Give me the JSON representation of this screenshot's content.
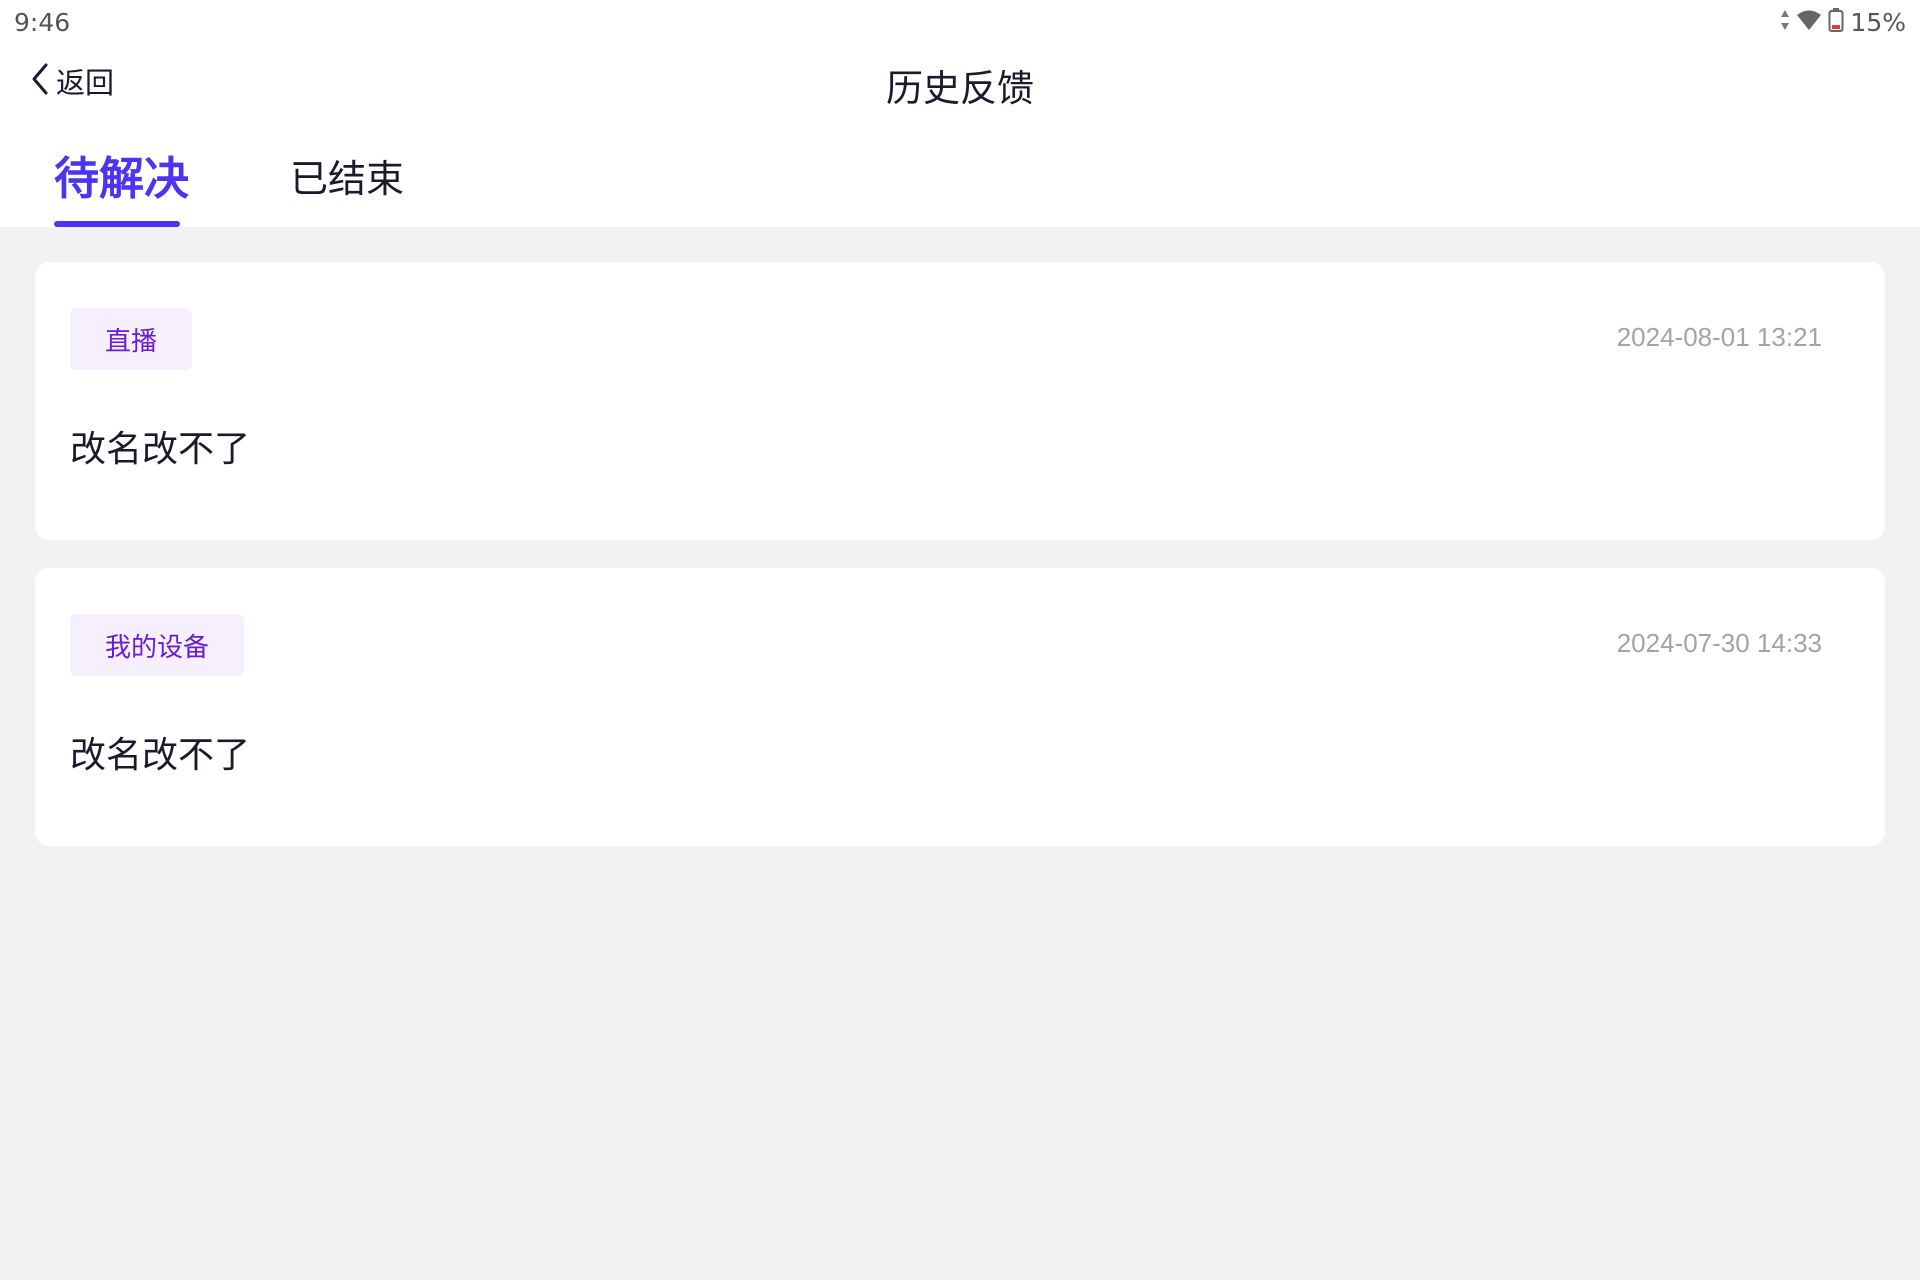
{
  "status_bar": {
    "time": "9:46",
    "battery_percent": "15%",
    "icons": [
      "data-arrows-icon",
      "wifi-icon",
      "battery-low-icon"
    ]
  },
  "nav": {
    "back_label": "返回",
    "title": "历史反馈"
  },
  "tabs": [
    {
      "label": "待解决",
      "active": true
    },
    {
      "label": "已结束",
      "active": false
    }
  ],
  "feedback": [
    {
      "category": "直播",
      "time": "2024-08-01 13:21",
      "content": "改名改不了"
    },
    {
      "category": "我的设备",
      "time": "2024-07-30 14:33",
      "content": "改名改不了"
    }
  ],
  "colors": {
    "accent": "#4b34f2",
    "badge_bg": "#f6f0fe",
    "badge_text": "#6a1bd6",
    "page_bg": "#f2f2f4",
    "timestamp": "#a3a3a8",
    "battery_low": "#e53935"
  }
}
